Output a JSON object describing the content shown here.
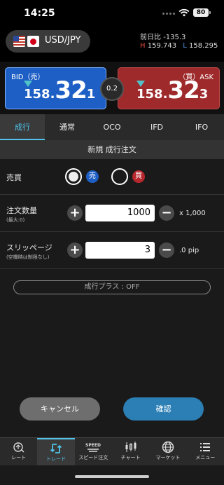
{
  "status_bar": {
    "time": "14:25",
    "battery": "80"
  },
  "header": {
    "pair": "USD/JPY",
    "prev_day_change_label": "前日比",
    "prev_day_change_value": "-135.3",
    "high_label": "H",
    "high_value": "159.743",
    "low_label": "L",
    "low_value": "158.295"
  },
  "prices": {
    "bid_label": "BID（売）",
    "bid_small": "158.",
    "bid_big": "32",
    "bid_pip": "1",
    "ask_label": "（買）ASK",
    "ask_small": "158.",
    "ask_big": "32",
    "ask_pip": "3",
    "spread": "0.2"
  },
  "tabs": [
    {
      "label": "成行",
      "active": true
    },
    {
      "label": "通常",
      "active": false
    },
    {
      "label": "OCO",
      "active": false
    },
    {
      "label": "IFD",
      "active": false
    },
    {
      "label": "IFO",
      "active": false
    }
  ],
  "subtitle": "新規 成行注文",
  "form": {
    "side_label": "売買",
    "sell_badge": "売",
    "buy_badge": "買",
    "qty_label": "注文数量",
    "qty_sub": "(最大:0)",
    "qty_value": "1000",
    "qty_unit": "x 1,000",
    "slip_label": "スリッページ",
    "slip_sub": "(空欄時は制限なし)",
    "slip_value": "3",
    "slip_unit": ".0 pip",
    "plus": "+",
    "minus": "−",
    "market_plus": "成行プラス : OFF"
  },
  "actions": {
    "cancel": "キャンセル",
    "confirm": "確認"
  },
  "colors": {
    "accent": "#4fc3e8",
    "bid": "#1e5fc5",
    "ask": "#9e2a2b",
    "sell": "#1e5fc5",
    "buy": "#b7282e"
  },
  "bottom_nav": [
    {
      "label": "レート",
      "icon": "rate-icon"
    },
    {
      "label": "トレード",
      "icon": "trade-icon",
      "active": true
    },
    {
      "label": "スピード注文",
      "icon": "speed-order-icon"
    },
    {
      "label": "チャート",
      "icon": "chart-icon"
    },
    {
      "label": "マーケット",
      "icon": "globe-icon"
    },
    {
      "label": "メニュー",
      "icon": "menu-icon"
    }
  ],
  "nav_icon_text": {
    "speed": "SPEED"
  }
}
